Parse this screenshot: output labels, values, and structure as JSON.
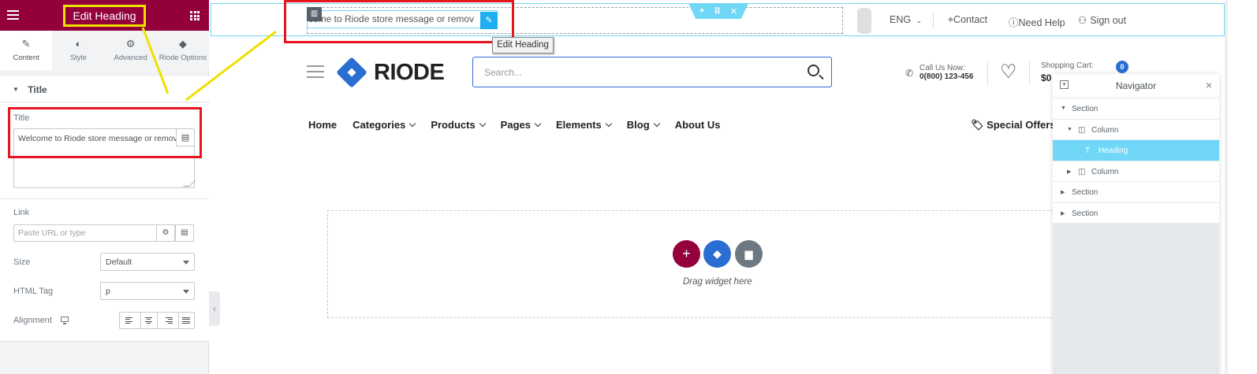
{
  "panel": {
    "title": "Edit Heading",
    "tabs": [
      {
        "label": "Content",
        "icon": "pencil-icon"
      },
      {
        "label": "Style",
        "icon": "contrast-icon"
      },
      {
        "label": "Advanced",
        "icon": "gear-icon"
      },
      {
        "label": "Riode Options",
        "icon": "diamond-icon"
      }
    ],
    "section_title": "Title",
    "title_label": "Title",
    "title_value": "Welcome to Riode store message or remov",
    "link_label": "Link",
    "link_placeholder": "Paste URL or type",
    "size_label": "Size",
    "size_value": "Default",
    "html_tag_label": "HTML Tag",
    "html_tag_value": "p",
    "alignment_label": "Alignment"
  },
  "canvas": {
    "heading_text": "come to Riode store message or remov",
    "tooltip": "Edit Heading",
    "topbar": {
      "language": "ENG",
      "contact": "Contact",
      "need_help": "Need Help",
      "sign_out": "Sign out"
    },
    "logo_text": "RIODE",
    "search_placeholder": "Search...",
    "call_label": "Call Us Now:",
    "call_number": "0(800) 123-456",
    "cart_label": "Shopping Cart:",
    "cart_amount": "$0",
    "cart_count": "0",
    "nav_items": [
      "Home",
      "Categories",
      "Products",
      "Pages",
      "Elements",
      "Blog",
      "About Us"
    ],
    "special_offers": "Special Offers",
    "drag_text": "Drag widget here"
  },
  "navigator": {
    "title": "Navigator",
    "rows": [
      {
        "label": "Section",
        "level": 0,
        "expanded": true
      },
      {
        "label": "Column",
        "level": 1,
        "expanded": true
      },
      {
        "label": "Heading",
        "level": 2,
        "selected": true
      },
      {
        "label": "Column",
        "level": 1,
        "expanded": false
      },
      {
        "label": "Section",
        "level": 0,
        "expanded": false
      },
      {
        "label": "Section",
        "level": 0,
        "expanded": false
      }
    ]
  },
  "colors": {
    "panel_header": "#93003c",
    "accent_blue": "#71d7f7",
    "brand_blue": "#2b6ed2",
    "annotation_red": "#e8141e",
    "annotation_yellow": "#f0e000"
  }
}
